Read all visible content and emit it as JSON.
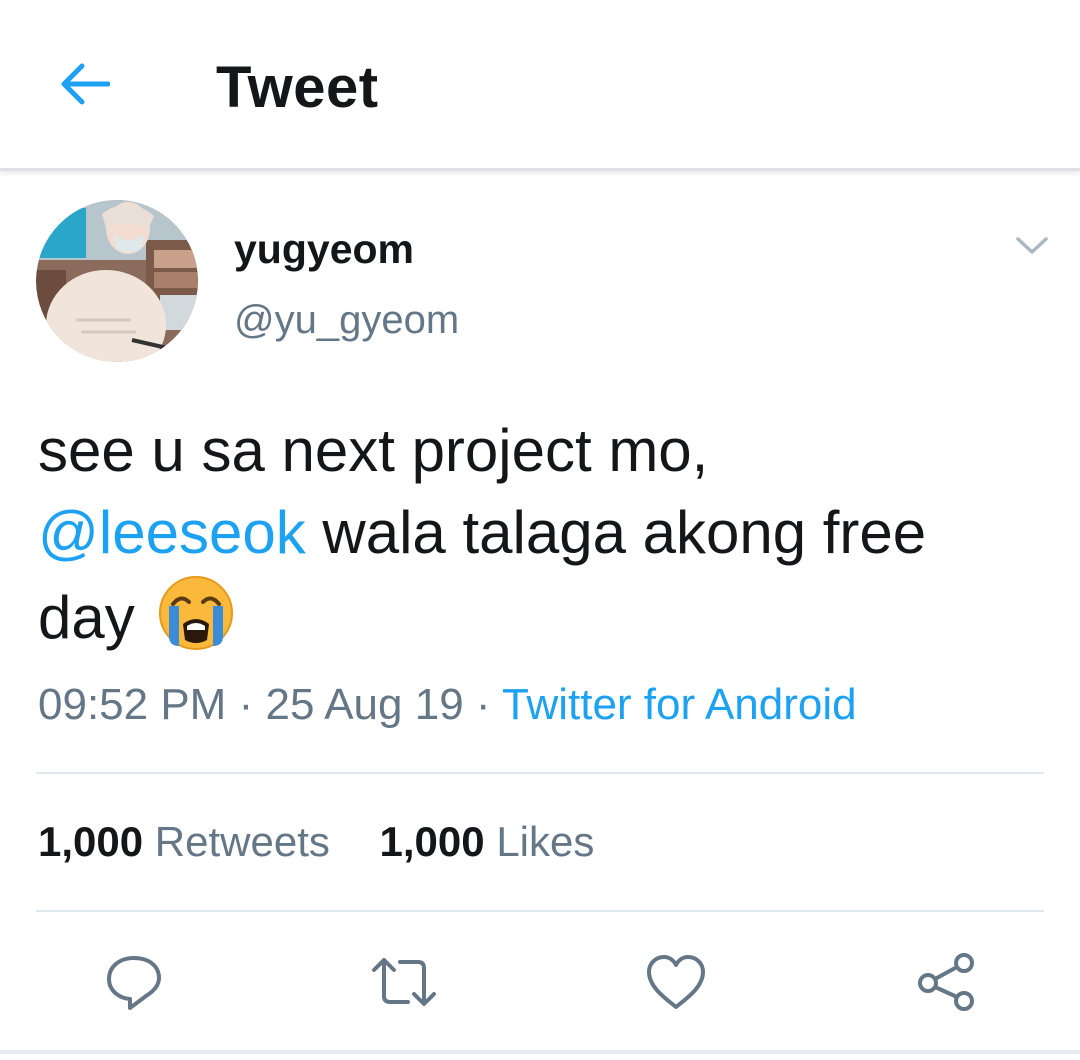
{
  "header": {
    "title": "Tweet",
    "back_icon": "arrow-left-icon"
  },
  "tweet": {
    "author": {
      "display_name": "yugyeom",
      "handle": "@yu_gyeom"
    },
    "text_line1": "see u sa next project mo,",
    "mention": "@leeseok",
    "text_after_mention": "wala talaga akong free",
    "text_line3": "day",
    "emoji": "loudly-crying-face",
    "time": "09:52 PM",
    "date": "25 Aug 19",
    "separator": "·",
    "source": "Twitter for Android",
    "stats": {
      "retweets_count": "1,000",
      "retweets_label": "Retweets",
      "likes_count": "1,000",
      "likes_label": "Likes"
    }
  },
  "actions": [
    "reply-icon",
    "retweet-icon",
    "like-icon",
    "share-icon"
  ],
  "colors": {
    "accent": "#1da1f2",
    "text_primary": "#14171a",
    "text_secondary": "#657786",
    "icon_gray": "#657786",
    "divider": "#e1e8ed"
  }
}
